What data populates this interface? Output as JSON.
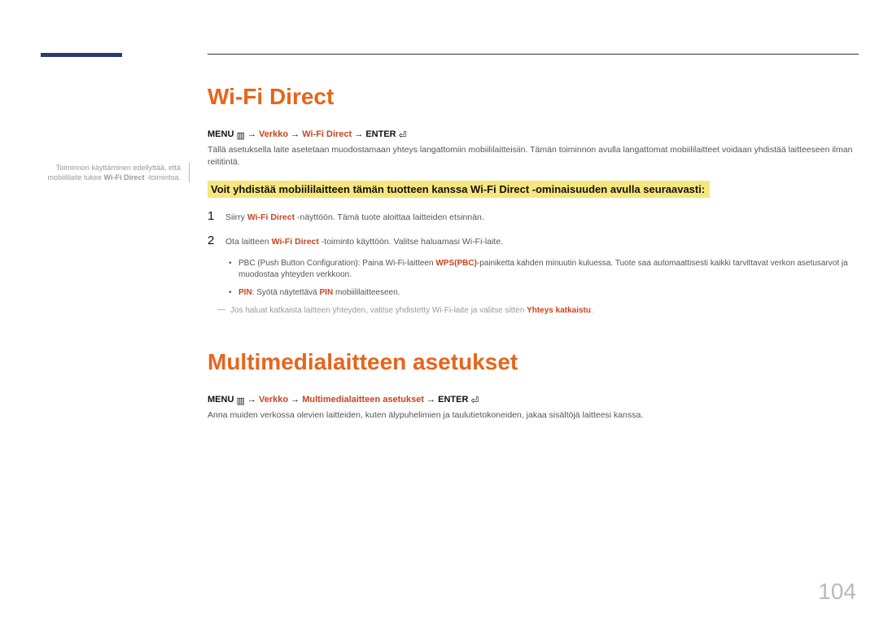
{
  "sidebar": {
    "note_prefix": "Toiminnon käyttäminen edellyttää, että mobiililaite tukee ",
    "note_bold": "Wi-Fi Direct",
    "note_suffix": " -toimintoa."
  },
  "section1": {
    "title": "Wi-Fi Direct",
    "nav_menu": "MENU",
    "nav_verkko": "Verkko",
    "nav_wifidirect": "Wi-Fi Direct",
    "nav_enter": "ENTER",
    "intro": "Tällä asetuksella laite asetetaan muodostamaan yhteys langattomiin mobiililaitteisiin. Tämän toiminnon avulla langattomat mobiililaitteet voidaan yhdistää laitteeseen ilman reititintä.",
    "highlight": "Voit yhdistää mobiililaitteen tämän tuotteen kanssa Wi-Fi Direct -ominaisuuden avulla seuraavasti:",
    "step1_num": "1",
    "step1_prefix": "Siirry ",
    "step1_orange": "Wi-Fi Direct",
    "step1_suffix": " -näyttöön. Tämä tuote aloittaa laitteiden etsinnän.",
    "step2_num": "2",
    "step2_prefix": "Ota laitteen ",
    "step2_orange": "Wi-Fi Direct",
    "step2_suffix": " -toiminto käyttöön. Valitse haluamasi Wi-Fi-laite.",
    "bullet1_prefix": "PBC (Push Button Configuration): Paina Wi-Fi-laitteen ",
    "bullet1_orange": "WPS(PBC)",
    "bullet1_suffix": "-painiketta kahden minuutin kuluessa. Tuote saa automaattisesti kaikki tarvittavat verkon asetusarvot ja muodostaa yhteyden verkkoon.",
    "bullet2_pin": "PIN",
    "bullet2_mid": ": Syötä näytettävä ",
    "bullet2_pin2": "PIN",
    "bullet2_suffix": " mobiililaitteeseen.",
    "note_prefix": "Jos haluat katkaista laitteen yhteyden, valitse yhdistetty Wi-Fi-laite ja valitse sitten ",
    "note_orange": "Yhteys katkaistu",
    "note_suffix": "."
  },
  "section2": {
    "title": "Multimedialaitteen asetukset",
    "nav_menu": "MENU",
    "nav_verkko": "Verkko",
    "nav_multimedia": "Multimedialaitteen asetukset",
    "nav_enter": "ENTER",
    "intro": "Anna muiden verkossa olevien laitteiden, kuten älypuhelimien ja taulutietokoneiden, jakaa sisältöjä laitteesi kanssa."
  },
  "pageNumber": "104"
}
